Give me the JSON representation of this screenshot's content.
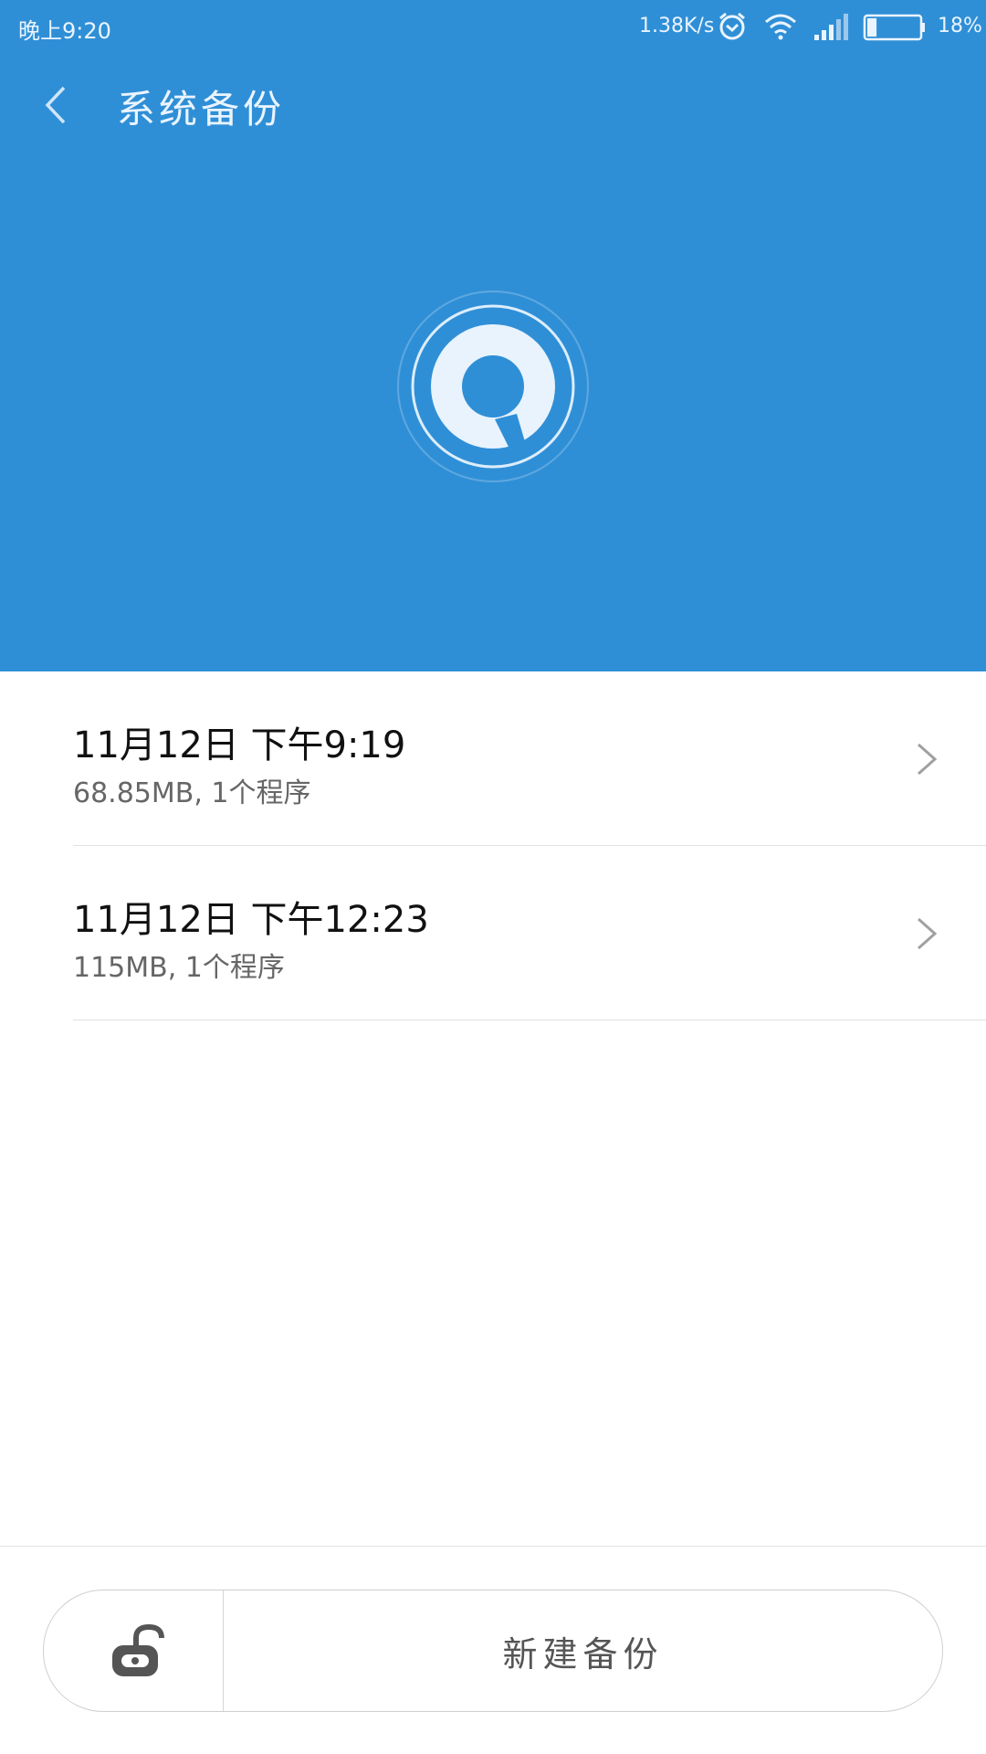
{
  "status_bar": {
    "time": "晚上9:20",
    "net_speed": "1.38K/s",
    "battery_pct": "18%",
    "battery_level": 0.18,
    "icons": [
      "alarm-icon",
      "wifi-icon",
      "signal-icon",
      "battery-icon"
    ]
  },
  "header": {
    "title": "系统备份",
    "back_icon": "chevron-left-icon",
    "logo_icon": "backup-logo-icon",
    "color": "#2f8fd6"
  },
  "backups": [
    {
      "title": "11月12日 下午9:19",
      "detail": "68.85MB, 1个程序"
    },
    {
      "title": "11月12日 下午12:23",
      "detail": "115MB, 1个程序"
    }
  ],
  "bottom": {
    "lock_icon": "unlock-icon",
    "new_backup_label": "新建备份"
  }
}
